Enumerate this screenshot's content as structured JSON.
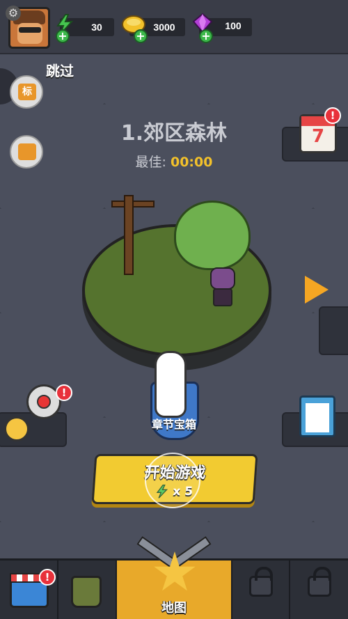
{
  "topbar": {
    "energy": "30",
    "gold": "3000",
    "gems": "100",
    "plus_symbol": "+"
  },
  "skip_label": "跳过",
  "left_buttons": {
    "mark_label": "标"
  },
  "level": {
    "title": "1.郊区森林",
    "best_label": "最佳:",
    "best_time": "00:00"
  },
  "calendar": {
    "day": "7"
  },
  "badge_text": "!",
  "chest_label": "章节宝箱",
  "start_button": {
    "label": "开始游戏",
    "cost": "x 5"
  },
  "bottom_nav": {
    "map_label": "地图"
  },
  "colors": {
    "accent_yellow": "#f2cb31",
    "energy_green": "#3cb84a",
    "badge_red": "#e8313b"
  }
}
